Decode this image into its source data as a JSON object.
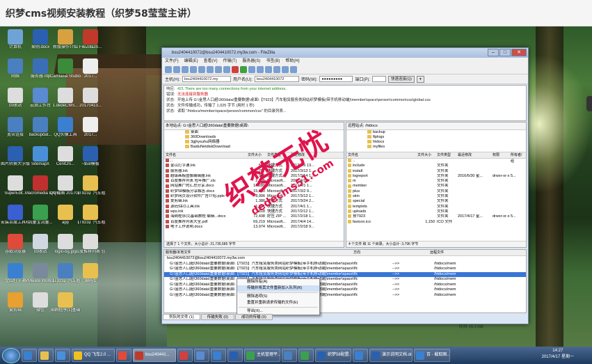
{
  "page_title": "织梦cms视频安装教程（织梦58莹莹主讲）",
  "desktop_icons": [
    {
      "label": "计算机",
      "color": "#6fa3d8"
    },
    {
      "label": "案例.docx",
      "color": "#2b5fb0"
    },
    {
      "label": "新版操作介绍",
      "color": "#d8a040"
    },
    {
      "label": "FileZilla20...",
      "color": "#c0392b"
    },
    {
      "label": "网络",
      "color": "#4a7fc0"
    },
    {
      "label": "服务器.rdp",
      "color": "#3a6fb8"
    },
    {
      "label": "Camtasia Studio",
      "color": "#3b8b3b"
    },
    {
      "label": "2017...",
      "color": "#eeeeee"
    },
    {
      "label": "回收站",
      "color": "#ddd"
    },
    {
      "label": "云测工作台",
      "color": "#5a8ad0"
    },
    {
      "label": "1.dedeCMS...",
      "color": "#dddddd"
    },
    {
      "label": "20170413...",
      "color": "#dddddd"
    },
    {
      "label": "宽带连接",
      "color": "#4a7fc0"
    },
    {
      "label": "backupdat...",
      "color": "#4a7fc0"
    },
    {
      "label": "QQ头像工具",
      "color": "#3a7fd0"
    },
    {
      "label": "2017...",
      "color": "#eee"
    },
    {
      "label": "图片转换大学版",
      "color": "#2b5fb0"
    },
    {
      "label": "SitemapX",
      "color": "#4a90d9"
    },
    {
      "label": "CentOS...",
      "color": "#dddddd"
    },
    {
      "label": "~$58模板",
      "color": "#2b5fb0"
    },
    {
      "label": "SuperEdit...",
      "color": "#dddddd"
    },
    {
      "label": "Macromedia Dreamwea...",
      "color": "#c03030"
    },
    {
      "label": "QQ截图 20170316...",
      "color": "#dddddd"
    },
    {
      "label": "【T923】汽车租赁...",
      "color": "#e8c050"
    },
    {
      "label": "安装百度工具栏",
      "color": "#3a5fd0"
    },
    {
      "label": "流量宝流量...",
      "color": "#3aa050"
    },
    {
      "label": "app",
      "color": "#e8c050"
    },
    {
      "label": "【T923】汽车租赁服务...",
      "color": "#e8c050"
    },
    {
      "label": "谷歌浏览器",
      "color": "#e04a3a"
    },
    {
      "label": "回收站",
      "color": "#cfd8e0"
    },
    {
      "label": "login-bg.jpg",
      "color": "#ddd"
    },
    {
      "label": "百度推荐列表 包年推广...",
      "color": "#ddd"
    },
    {
      "label": "金山打字通",
      "color": "#3a80d0"
    },
    {
      "label": "VMware Workstation",
      "color": "#7a8a9a"
    },
    {
      "label": "【T923】汽车租赁服务...",
      "color": "#4a80c0"
    },
    {
      "label": "源码库",
      "color": "#e8c050"
    },
    {
      "label": "爱剪辑",
      "color": "#e8a030"
    },
    {
      "label": "微信",
      "color": "#dddddd"
    },
    {
      "label": "海纳程序(1)基础教程",
      "color": "#e8c050"
    }
  ],
  "filezilla": {
    "title": "bsu2404410072@bsu2404410072.my3w.com - FileZilla",
    "menu": [
      "文件(F)",
      "编辑(E)",
      "查看(V)",
      "传输(T)",
      "服务器(S)",
      "书签(B)",
      "帮助(H)"
    ],
    "quickconnect": {
      "host_label": "主机(H):",
      "host": "bsu2404410072.my",
      "user_label": "用户名(U):",
      "user": "bsu2404410072",
      "pass_label": "密码(W):",
      "pass": "●●●●●●●●●",
      "port_label": "端口(P):",
      "port": "",
      "button": "快速连接(Q)"
    },
    "log": [
      {
        "k": "响应:",
        "v": "421 There are too many connections from your internet address.",
        "color": "#1a8a1a"
      },
      {
        "k": "错误:",
        "v": "无法连接到服务器",
        "color": "#d01010"
      },
      {
        "k": "状态:",
        "v": "开始上传 G:\\金思人口超\\360data\\重要数据\\桌面\\【T923】汽车租赁服务类网站织梦模板(带手机移动端)\\member\\space\\person\\common\\css\\global.css",
        "color": "#222"
      },
      {
        "k": "状态:",
        "v": "文件传输成功，传输了 1,025 字节 (用时 1 秒)",
        "color": "#222"
      },
      {
        "k": "状态:",
        "v": "读取 \"/htdocs/member/space/person/common/css\" 的目录列表...",
        "color": "#222"
      }
    ],
    "local": {
      "path_label": "本地站点:",
      "path": "G:\\金思人口超\\360data\\重要数据\\桌面\\",
      "tree": [
        "桌面",
        "360Downloads",
        "3gjhysuhu网络器",
        "BaiduNetdiskDownload"
      ],
      "headers": [
        "文件名",
        "文件大小",
        "文件类型",
        "最近修改"
      ],
      "files": [
        {
          "name": "..",
          "size": "",
          "type": "",
          "date": ""
        },
        {
          "name": "金山打字通.lnk",
          "size": "566",
          "type": "快捷方式",
          "date": "2017/4/6 13..."
        },
        {
          "name": "服务器.lnk",
          "size": "707",
          "type": "快捷方式",
          "date": "2017/3/13 1..."
        },
        {
          "name": "超级画板图像编辑器.lnk",
          "size": "909",
          "type": "快捷方式",
          "date": "2017/3/14 1..."
        },
        {
          "name": "百度推荐列表 包年推广.xls",
          "size": "2,105",
          "type": "Microsoft...",
          "date": "2017/4/1 1..."
        },
        {
          "name": "网站推广的汇总分享.docx",
          "size": "12,289",
          "type": "Microsoft...",
          "date": "2017/4/1 1..."
        },
        {
          "name": "织梦58模板分享解答.docx",
          "size": "15,020",
          "type": "Microsoft...",
          "date": "2017/3/2 9..."
        },
        {
          "name": "织梦网页设计软件广告介绍.pptx",
          "size": "8,996",
          "type": "Microsoft...",
          "date": "2017/3/13 1..."
        },
        {
          "name": "爱剪辑.lnk",
          "size": "1,386",
          "type": "快捷方式",
          "date": "2017/3/24 2..."
        },
        {
          "name": "源码SEO工具.lnk",
          "size": "1,391",
          "type": "快捷方式",
          "date": "2017/4/1 1..."
        },
        {
          "name": "wps.lnk",
          "size": "818",
          "type": "快捷方式",
          "date": "2017/2/12 1..."
        },
        {
          "name": "海纳程序(1)基础教程 编辑...docx",
          "size": "72,438",
          "type": "好压 ZIP ...",
          "date": "2017/2/18 1..."
        },
        {
          "name": "百度推荐列表大全.pdf",
          "size": "69,219",
          "type": "Microsoft...",
          "date": "2017/4/4 14..."
        },
        {
          "name": "电子工作说明.docx",
          "size": "13,974",
          "type": "Microsoft...",
          "date": "2017/2/18 9..."
        }
      ],
      "status": "选择了 1 个文件。大小总计: 21,735,585 字节"
    },
    "remote": {
      "path_label": "远程站点:",
      "path": "/htdocs",
      "tree": [
        "backup",
        "ftplogs",
        "htdocs",
        "myfiles"
      ],
      "headers": [
        "文件名",
        "文件大小",
        "文件类型",
        "最近修改",
        "权限",
        "所有者/组"
      ],
      "files": [
        {
          "name": "..",
          "size": "",
          "type": "",
          "date": "",
          "perm": "",
          "owner": ""
        },
        {
          "name": "include",
          "size": "",
          "type": "文件夹",
          "date": "",
          "perm": "",
          "owner": ""
        },
        {
          "name": "install",
          "size": "",
          "type": "文件夹",
          "date": "",
          "perm": "",
          "owner": ""
        },
        {
          "name": "logreport",
          "size": "",
          "type": "文件夹",
          "date": "2016/6/30 星...",
          "perm": "drwxr-xr-x",
          "owner": "5..."
        },
        {
          "name": "m",
          "size": "",
          "type": "文件夹",
          "date": "",
          "perm": "",
          "owner": ""
        },
        {
          "name": "member",
          "size": "",
          "type": "文件夹",
          "date": "",
          "perm": "",
          "owner": ""
        },
        {
          "name": "plus",
          "size": "",
          "type": "文件夹",
          "date": "",
          "perm": "",
          "owner": ""
        },
        {
          "name": "skin",
          "size": "",
          "type": "文件夹",
          "date": "",
          "perm": "",
          "owner": ""
        },
        {
          "name": "special",
          "size": "",
          "type": "文件夹",
          "date": "",
          "perm": "",
          "owner": ""
        },
        {
          "name": "templets",
          "size": "",
          "type": "文件夹",
          "date": "",
          "perm": "",
          "owner": ""
        },
        {
          "name": "uploads",
          "size": "",
          "type": "文件夹",
          "date": "",
          "perm": "",
          "owner": ""
        },
        {
          "name": "技T923",
          "size": "",
          "type": "文件夹",
          "date": "2017/4/17 星...",
          "perm": "drwxr-xr-x",
          "owner": "5..."
        },
        {
          "name": "favicon.ico",
          "size": "1,150",
          "type": "ICO 文件",
          "date": "",
          "perm": "",
          "owner": ""
        }
      ],
      "status": "4 个文件 和 11 个目录。大小总计: 3,796 字节"
    },
    "queue": {
      "headers": [
        "服务器/本地文件",
        "方向",
        "远程文件"
      ],
      "server": "bsu2404410072@bsu2404410072.my3w.com",
      "rows": [
        {
          "local": "G:\\金思人口超\\360data\\重要数据\\桌面\\【T923】汽车租赁服务类网站织梦模板(带手机移动端)\\member\\space\\flower\\side_news.htm",
          "dir": "-->>",
          "remote": "/htdocs/mem"
        },
        {
          "local": "G:\\金思人口超\\360data\\重要数据\\桌面\\【T923】汽车租赁服务类网站织梦模板(带手机移动端)\\member\\space\\flower\\images\\bg.jpg",
          "dir": "-->>",
          "remote": "/htdocs/mem"
        },
        {
          "local": "G:\\金思人口超\\360data\\重要数据\\桌面\\【T923】汽车租赁服务类网站织梦模板(带手机移动端)\\member\\space\\flower\\images\\bgm.gif",
          "dir": "-->>",
          "remote": "/htdocs/mem"
        },
        {
          "local": "G:\\金思人口超\\360data\\重要数据\\桌面\\【T923】汽车租赁服务类网站织梦模板(带手机移动端)\\member\\space\\flower\\images\\bodybg.png",
          "dir": "-->>",
          "remote": "/htdocs/mem"
        },
        {
          "local": "G:\\金思人口超\\360data\\重要数据\\桌面\\【T923】汽车租赁服务类网站织梦模板(带手机移动端)\\member\\space\\flower\\images\\boxbg.png",
          "dir": "-->>",
          "remote": "/htdocs/mem"
        },
        {
          "local": "G:\\金思人口超\\360data\\重要数据\\桌面\\【T923】汽车租赁服务类网站织梦模板(带手机移动端)\\member\\space\\flower\\images\\close.jpg",
          "dir": "-->>",
          "remote": "/htdocs/mem"
        },
        {
          "local": "G:\\金思人口超\\360data\\重要数据\\桌面\\【T923】汽车租赁服务类网站织梦模板(带手机移动端)\\member\\space\\flower\\images\\del.png",
          "dir": "-->>",
          "remote": "/htdocs/mem"
        }
      ],
      "tabs": [
        "列队的文件 (1)",
        "传输失败 (0)",
        "成功的传输 (0)"
      ],
      "status": "队列: 15.1 KiB"
    },
    "context_menu": [
      "删除所有(A)",
      "传输并将其文件重新加入队列(R)",
      "删除选项(S)",
      "重置并重新请求传输的文件(E)",
      "导出(X)..."
    ]
  },
  "taskbar": {
    "items": [
      {
        "label": "",
        "color": "#3a80d0"
      },
      {
        "label": "",
        "color": "#e8c050"
      },
      {
        "label": "",
        "color": "#4a90d9"
      },
      {
        "label": "QQ 飞车2.0 ...",
        "color": "#f0c020"
      },
      {
        "label": "",
        "color": "#e04a3a"
      },
      {
        "label": "bsu240441...",
        "color": "#c0392b"
      },
      {
        "label": "",
        "color": "#d04040"
      },
      {
        "label": "",
        "color": "#5a8ad0"
      },
      {
        "label": "",
        "color": "#3a7fd0"
      },
      {
        "label": "",
        "color": "#2a5fb0"
      },
      {
        "label": "主机管理平...",
        "color": "#3aa050"
      },
      {
        "label": "",
        "color": "#4a80c0"
      },
      {
        "label": "",
        "color": "#3aa050"
      },
      {
        "label": "织梦58配置...",
        "color": "#2a60b0"
      },
      {
        "label": "",
        "color": "#3a80d0"
      },
      {
        "label": "演示说明文档.docx...",
        "color": "#2b5fb0"
      },
      {
        "label": "百 - 截取图...",
        "color": "#3a80d0"
      }
    ],
    "clock_time": "14:27",
    "clock_date": "2017/4/17 星期一"
  },
  "watermark_line1": "织梦无忧",
  "watermark_line2": "dedecms51.com"
}
